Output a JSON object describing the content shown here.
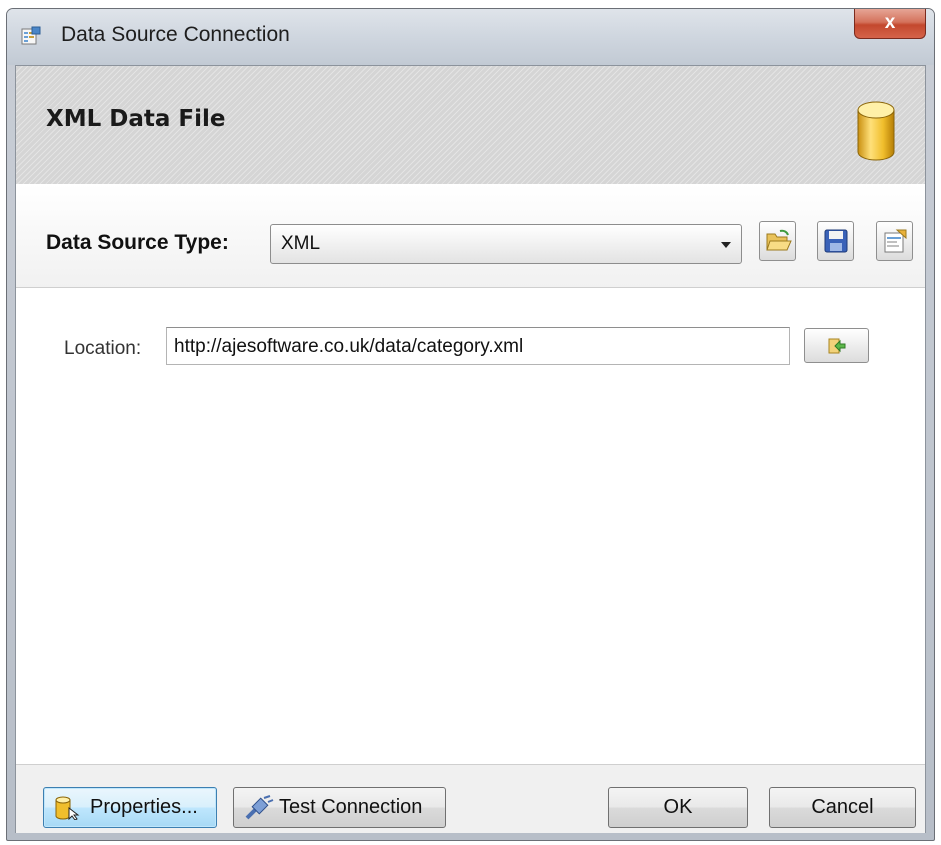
{
  "window": {
    "title": "Data Source Connection",
    "close_glyph": "x"
  },
  "header": {
    "title": "XML Data File",
    "icon": "database-cylinder-icon"
  },
  "type_bar": {
    "label": "Data Source Type:",
    "selected": "XML",
    "buttons": [
      "open-folder-icon",
      "save-disk-icon",
      "properties-page-icon"
    ]
  },
  "location": {
    "label": "Location:",
    "value": "http://ajesoftware.co.uk/data/category.xml",
    "browse_icon": "go-arrow-icon"
  },
  "footer": {
    "properties_label": "Properties...",
    "test_label": "Test Connection",
    "ok_label": "OK",
    "cancel_label": "Cancel"
  },
  "colors": {
    "close_button": "#c3482e",
    "focus_button": "#bee6fd",
    "database_icon": "#e8b92a"
  }
}
